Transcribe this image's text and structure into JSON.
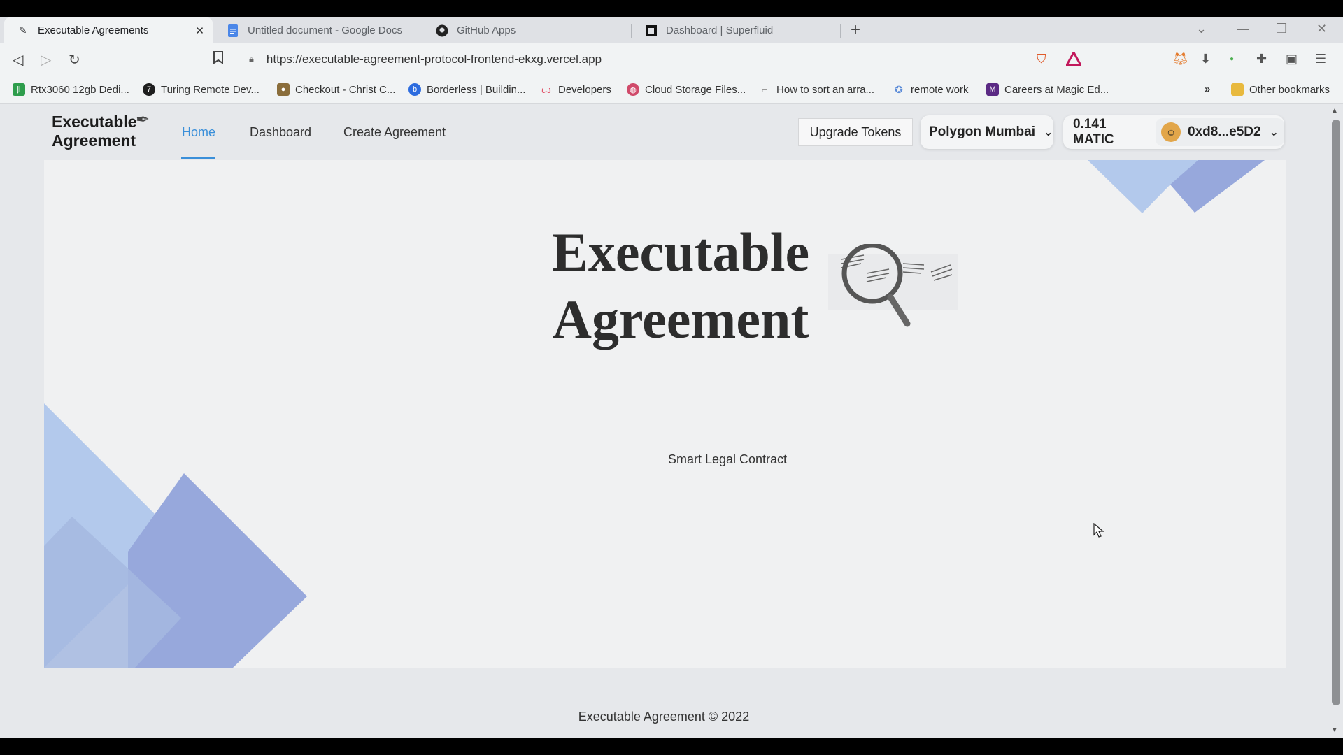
{
  "tabs": [
    {
      "label": "Executable Agreements",
      "icon": "page-icon",
      "active": true
    },
    {
      "label": "Untitled document - Google Docs",
      "icon": "docs-icon"
    },
    {
      "label": "GitHub Apps",
      "icon": "github-icon"
    },
    {
      "label": "Dashboard | Superfluid",
      "icon": "superfluid-icon"
    }
  ],
  "toolbar": {
    "url": "https://executable-agreement-protocol-frontend-ekxg.vercel.app"
  },
  "bookmarks": [
    {
      "label": "Rtx3060 12gb Dedi...",
      "color": "#2e9d4c"
    },
    {
      "label": "Turing Remote Dev...",
      "color": "#1e1e1e"
    },
    {
      "label": "Checkout - Christ C...",
      "color": "#8a6d3b"
    },
    {
      "label": "Borderless | Buildin...",
      "color": "#2d6cdf"
    },
    {
      "label": "Developers",
      "color": "#e2546a"
    },
    {
      "label": "Cloud Storage Files...",
      "color": "#d04a6a"
    },
    {
      "label": "How to sort an arra...",
      "color": "#999999"
    },
    {
      "label": "remote work",
      "color": "#5b8bd8"
    },
    {
      "label": "Careers at Magic Ed...",
      "color": "#5b2a84"
    }
  ],
  "bookmarks_more": "»",
  "other_bookmarks": "Other bookmarks",
  "app": {
    "logo_line1": "Executable",
    "logo_line2": "Agreement",
    "nav": {
      "home": "Home",
      "dashboard": "Dashboard",
      "create": "Create Agreement"
    },
    "upgrade_label": "Upgrade Tokens",
    "network": "Polygon Mumbai",
    "balance": "0.141 MATIC",
    "account": "0xd8...e5D2",
    "hero_line1": "Executable",
    "hero_line2": "Agreement",
    "subtitle": "Smart Legal Contract",
    "footer": "Executable Agreement © 2022"
  },
  "colors": {
    "accent": "#3a8fd9",
    "shape_light": "#b3c9ec",
    "shape_dark": "#97a8dc"
  }
}
